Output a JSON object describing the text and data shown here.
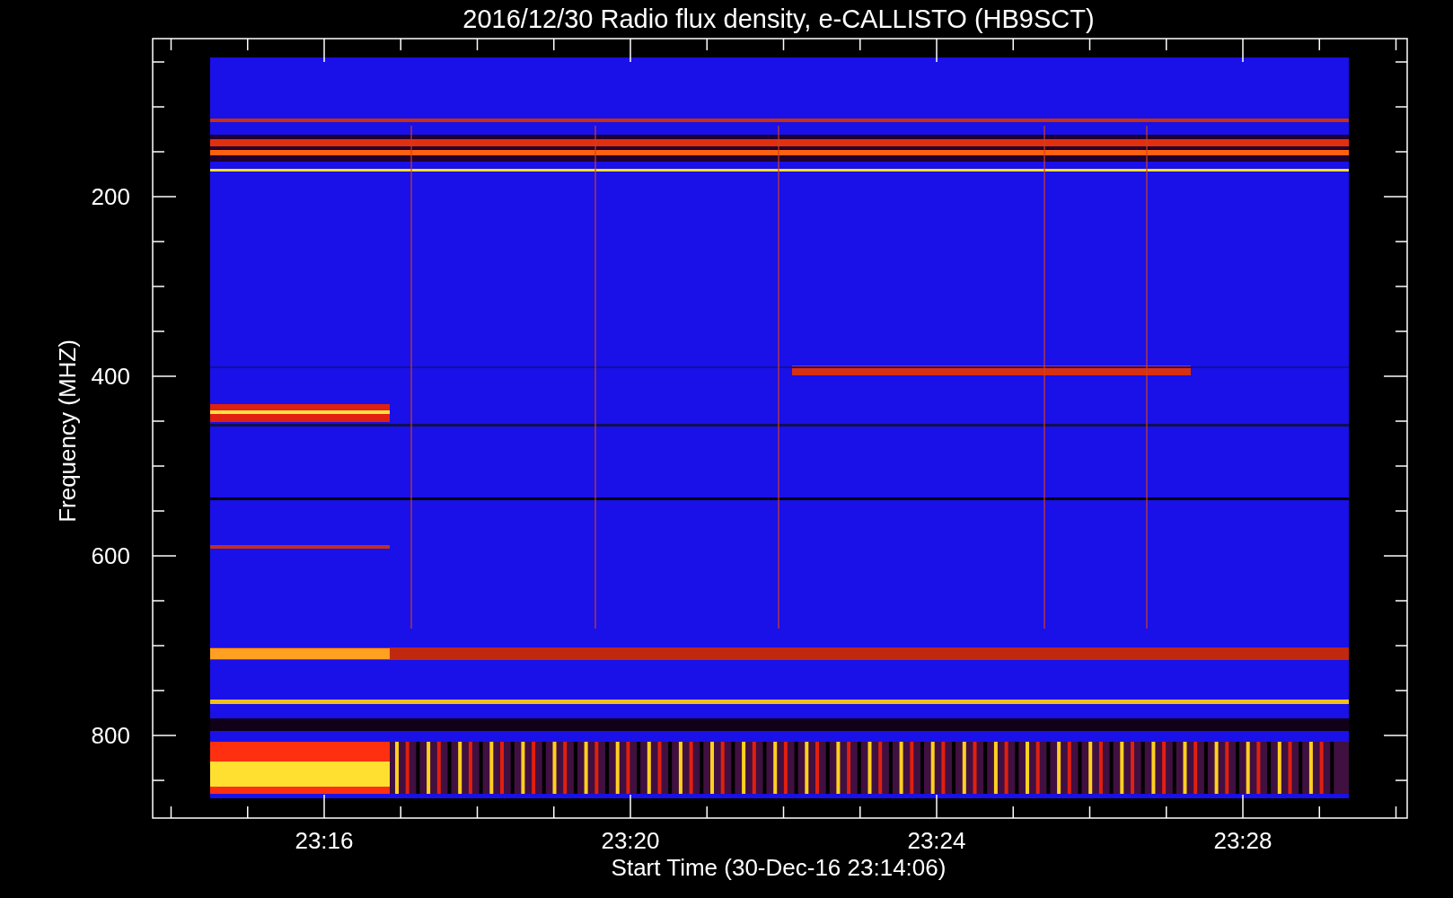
{
  "title": "2016/12/30  Radio flux density, e-CALLISTO (HB9SCT)",
  "y_axis": {
    "label": "Frequency (MHZ)",
    "ticks": [
      "200",
      "400",
      "600",
      "800"
    ]
  },
  "x_axis": {
    "label": "Start Time (30-Dec-16 23:14:06)",
    "ticks": [
      "23:16",
      "23:20",
      "23:24",
      "23:28"
    ]
  }
}
